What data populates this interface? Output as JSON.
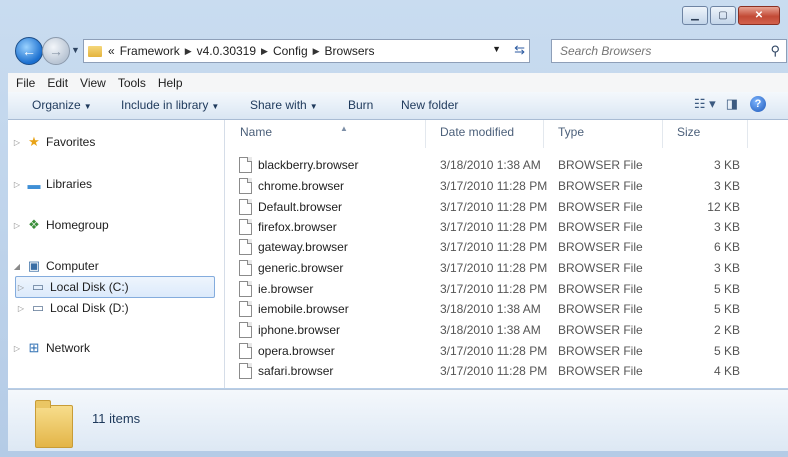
{
  "window": {
    "buttons": [
      "minimize",
      "maximize",
      "close"
    ]
  },
  "address": {
    "overflow": "«",
    "crumbs": [
      "Framework",
      "v4.0.30319",
      "Config",
      "Browsers"
    ],
    "search_placeholder": "Search Browsers"
  },
  "menu": {
    "items": [
      "File",
      "Edit",
      "View",
      "Tools",
      "Help"
    ]
  },
  "commands": {
    "organize": "Organize",
    "include": "Include in library",
    "share": "Share with",
    "burn": "Burn",
    "new_folder": "New folder"
  },
  "nav": {
    "favorites": "Favorites",
    "libraries": "Libraries",
    "homegroup": "Homegroup",
    "computer": "Computer",
    "disk_c": "Local Disk (C:)",
    "disk_d": "Local Disk (D:)",
    "network": "Network"
  },
  "columns": {
    "name": "Name",
    "date": "Date modified",
    "type": "Type",
    "size": "Size"
  },
  "files": [
    {
      "name": "blackberry.browser",
      "date": "3/18/2010 1:38 AM",
      "type": "BROWSER File",
      "size": "3 KB"
    },
    {
      "name": "chrome.browser",
      "date": "3/17/2010 11:28 PM",
      "type": "BROWSER File",
      "size": "3 KB"
    },
    {
      "name": "Default.browser",
      "date": "3/17/2010 11:28 PM",
      "type": "BROWSER File",
      "size": "12 KB"
    },
    {
      "name": "firefox.browser",
      "date": "3/17/2010 11:28 PM",
      "type": "BROWSER File",
      "size": "3 KB"
    },
    {
      "name": "gateway.browser",
      "date": "3/17/2010 11:28 PM",
      "type": "BROWSER File",
      "size": "6 KB"
    },
    {
      "name": "generic.browser",
      "date": "3/17/2010 11:28 PM",
      "type": "BROWSER File",
      "size": "3 KB"
    },
    {
      "name": "ie.browser",
      "date": "3/17/2010 11:28 PM",
      "type": "BROWSER File",
      "size": "5 KB"
    },
    {
      "name": "iemobile.browser",
      "date": "3/18/2010 1:38 AM",
      "type": "BROWSER File",
      "size": "5 KB"
    },
    {
      "name": "iphone.browser",
      "date": "3/18/2010 1:38 AM",
      "type": "BROWSER File",
      "size": "2 KB"
    },
    {
      "name": "opera.browser",
      "date": "3/17/2010 11:28 PM",
      "type": "BROWSER File",
      "size": "5 KB"
    },
    {
      "name": "safari.browser",
      "date": "3/17/2010 11:28 PM",
      "type": "BROWSER File",
      "size": "4 KB"
    }
  ],
  "status": {
    "count": "11 items"
  },
  "colors": {
    "selection_border": "#84acdd",
    "frame": "#c9dcf0"
  }
}
